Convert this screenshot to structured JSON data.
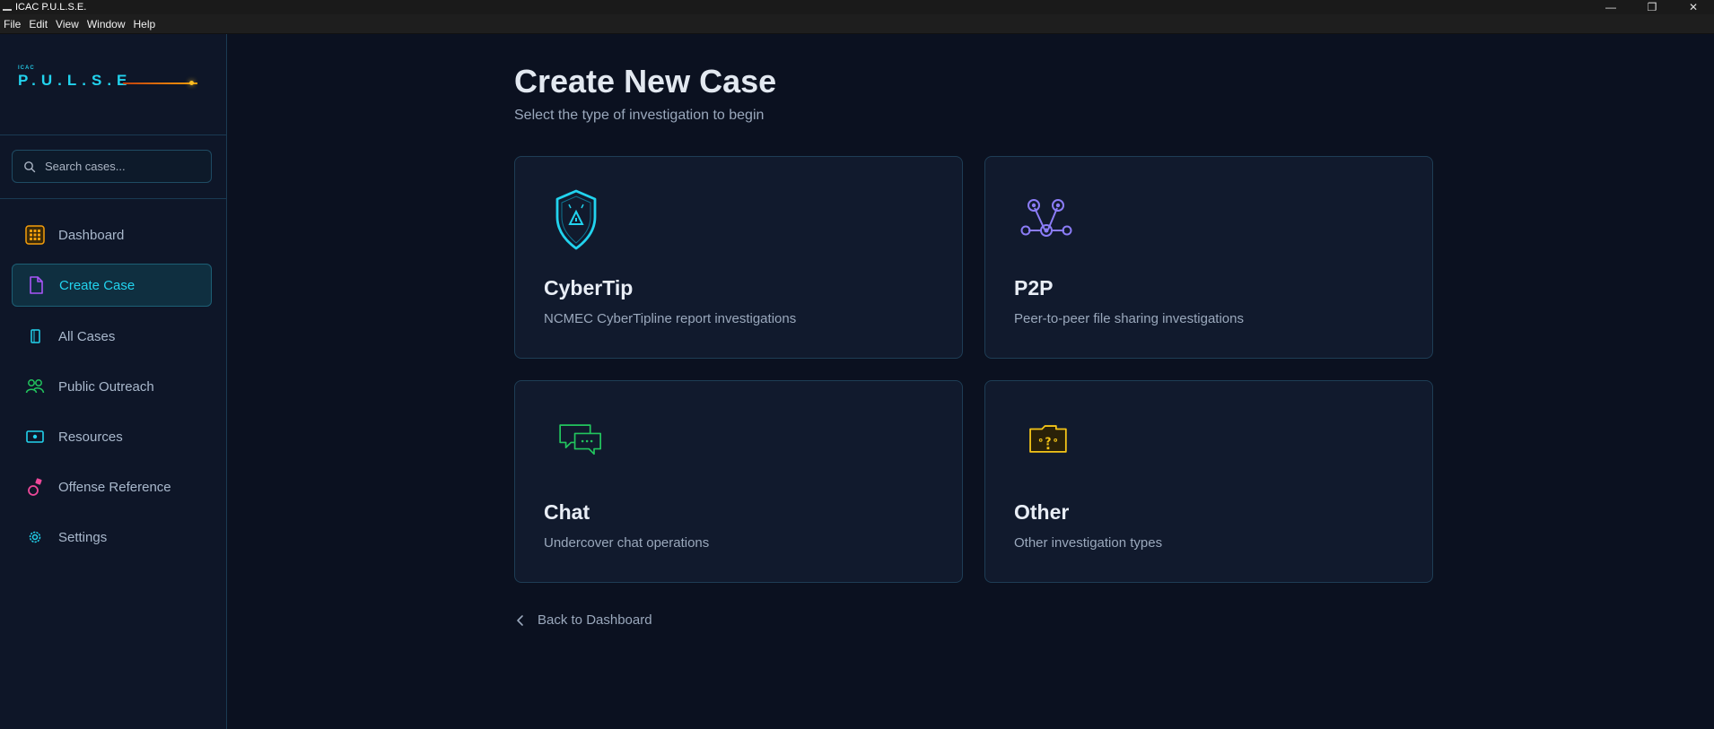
{
  "window": {
    "title": "ICAC P.U.L.S.E.",
    "controls": {
      "minimize": "—",
      "maximize": "❐",
      "close": "✕"
    }
  },
  "menu": [
    "File",
    "Edit",
    "View",
    "Window",
    "Help"
  ],
  "sidebar": {
    "logo": {
      "small": "ICAC",
      "main": "P.U.L.S.E"
    },
    "search_placeholder": "Search cases...",
    "items": [
      {
        "label": "Dashboard",
        "icon": "grid-icon",
        "color": "#f59e0b"
      },
      {
        "label": "Create Case",
        "icon": "document-icon",
        "color": "#a855f7",
        "active": true
      },
      {
        "label": "All Cases",
        "icon": "folder-icon",
        "color": "#22d3ee"
      },
      {
        "label": "Public Outreach",
        "icon": "people-icon",
        "color": "#22c55e"
      },
      {
        "label": "Resources",
        "icon": "resources-icon",
        "color": "#22d3ee"
      },
      {
        "label": "Offense Reference",
        "icon": "alert-icon",
        "color": "#ec4899"
      },
      {
        "label": "Settings",
        "icon": "gear-icon",
        "color": "#22d3ee"
      }
    ]
  },
  "main": {
    "title": "Create New Case",
    "subtitle": "Select the type of investigation to begin",
    "cards": [
      {
        "title": "CyberTip",
        "description": "NCMEC CyberTipline report investigations",
        "icon": "shield-icon",
        "color": "#22d3ee"
      },
      {
        "title": "P2P",
        "description": "Peer-to-peer file sharing investigations",
        "icon": "network-icon",
        "color": "#8b7cf6"
      },
      {
        "title": "Chat",
        "description": "Undercover chat operations",
        "icon": "chat-icon",
        "color": "#22c55e"
      },
      {
        "title": "Other",
        "description": "Other investigation types",
        "icon": "folder-question-icon",
        "color": "#f5c518"
      }
    ],
    "back_label": "Back to Dashboard"
  }
}
